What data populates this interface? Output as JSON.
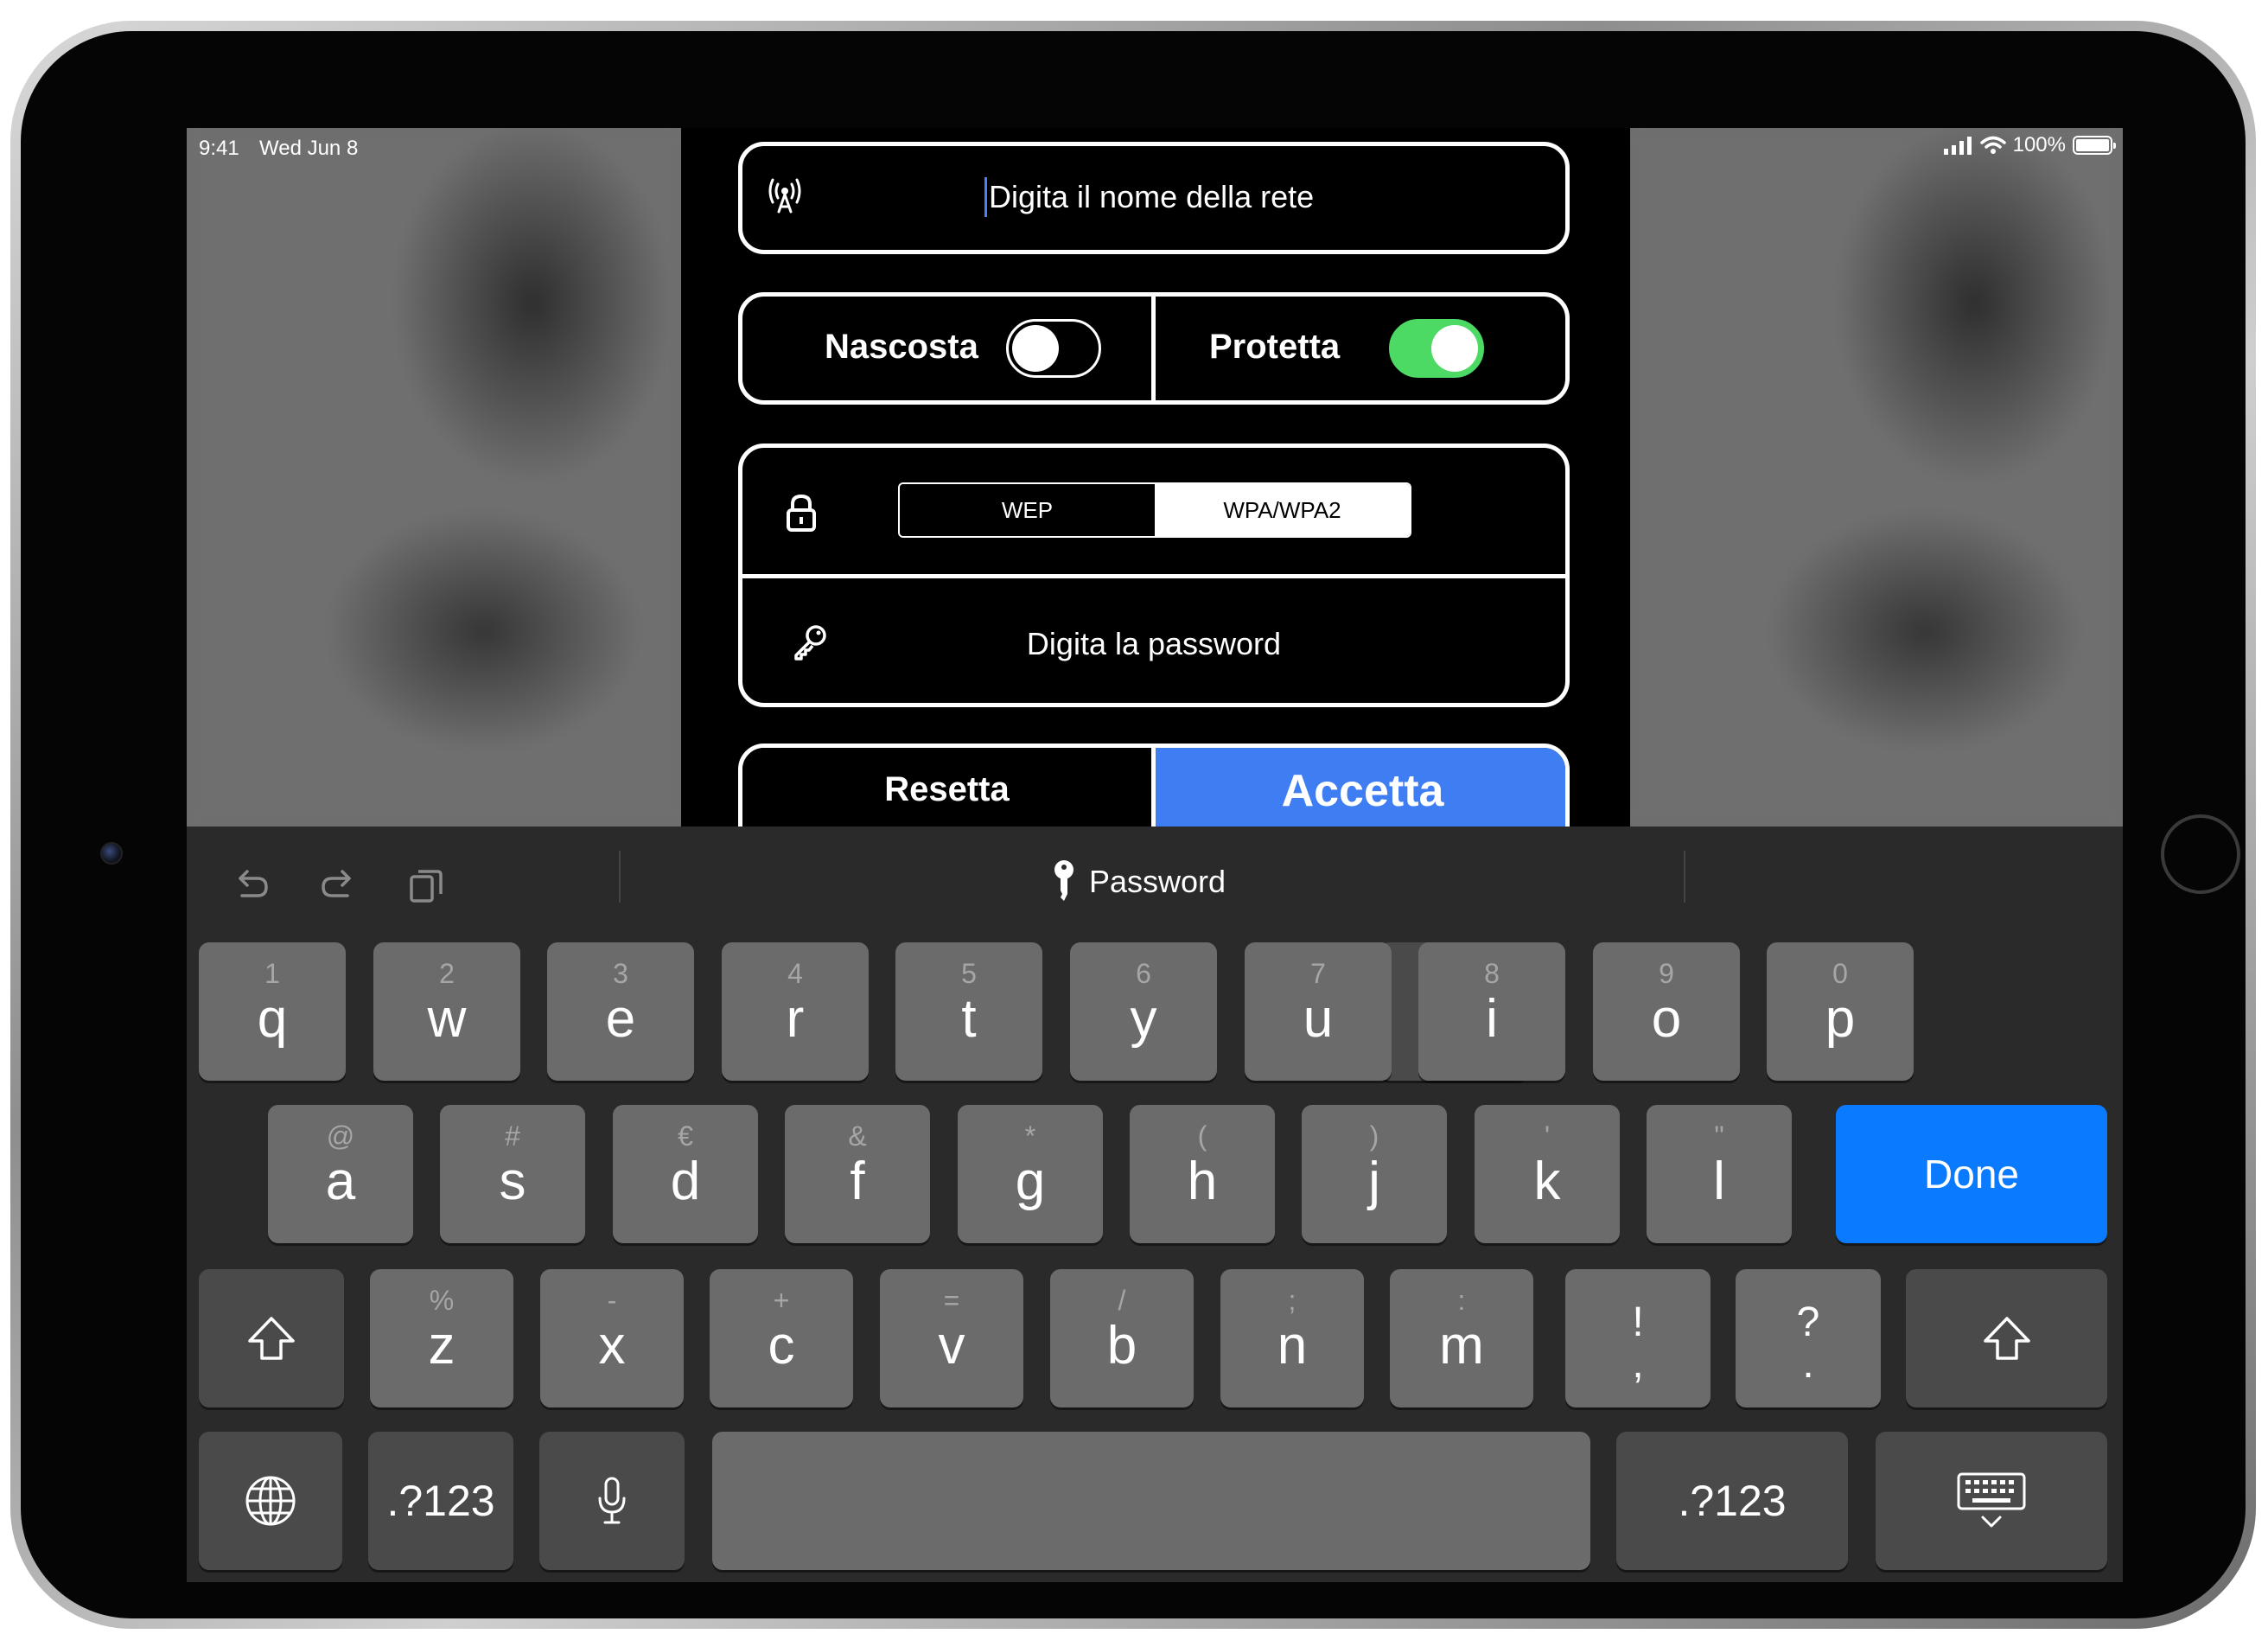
{
  "status_bar": {
    "time": "9:41",
    "date": "Wed Jun 8",
    "battery": "100%",
    "battery_level": 1.0
  },
  "form": {
    "network_name_placeholder": "Digita il nome della rete",
    "hidden_label": "Nascosta",
    "hidden_on": false,
    "protected_label": "Protetta",
    "protected_on": true,
    "security_options": [
      "WEP",
      "WPA/WPA2"
    ],
    "security_selected": "WPA/WPA2",
    "password_placeholder": "Digita la password",
    "reset_label": "Resetta",
    "accept_label": "Accetta"
  },
  "keyboard": {
    "suggestion": "Password",
    "row1": [
      {
        "main": "q",
        "alt": "1"
      },
      {
        "main": "w",
        "alt": "2"
      },
      {
        "main": "e",
        "alt": "3"
      },
      {
        "main": "r",
        "alt": "4"
      },
      {
        "main": "t",
        "alt": "5"
      },
      {
        "main": "y",
        "alt": "6"
      },
      {
        "main": "u",
        "alt": "7"
      },
      {
        "main": "i",
        "alt": "8"
      },
      {
        "main": "o",
        "alt": "9"
      },
      {
        "main": "p",
        "alt": "0"
      }
    ],
    "row2": [
      {
        "main": "a",
        "alt": "@"
      },
      {
        "main": "s",
        "alt": "#"
      },
      {
        "main": "d",
        "alt": "€"
      },
      {
        "main": "f",
        "alt": "&"
      },
      {
        "main": "g",
        "alt": "*"
      },
      {
        "main": "h",
        "alt": "("
      },
      {
        "main": "j",
        "alt": ")"
      },
      {
        "main": "k",
        "alt": "'"
      },
      {
        "main": "l",
        "alt": "\""
      }
    ],
    "row3": [
      {
        "main": "z",
        "alt": "%"
      },
      {
        "main": "x",
        "alt": "-"
      },
      {
        "main": "c",
        "alt": "+"
      },
      {
        "main": "v",
        "alt": "="
      },
      {
        "main": "b",
        "alt": "/"
      },
      {
        "main": "n",
        "alt": ";"
      },
      {
        "main": "m",
        "alt": ":"
      }
    ],
    "punct1": {
      "top": "!",
      "bottom": ","
    },
    "punct2": {
      "top": "?",
      "bottom": "."
    },
    "done_label": "Done",
    "numbers_label_left": ".?123",
    "numbers_label_right": ".?123"
  },
  "icons": {
    "network": "antenna-icon",
    "lock": "lock-icon",
    "key": "key-icon",
    "undo": "undo-icon",
    "redo": "redo-icon",
    "paste": "clipboard-icon",
    "backspace": "backspace-icon",
    "shift": "shift-icon",
    "globe": "globe-icon",
    "mic": "microphone-icon",
    "hide_keyboard": "keyboard-dismiss-icon"
  },
  "colors": {
    "accent": "#3f7df3",
    "toggle_on": "#4cd964",
    "done_key": "#0a7aff"
  }
}
